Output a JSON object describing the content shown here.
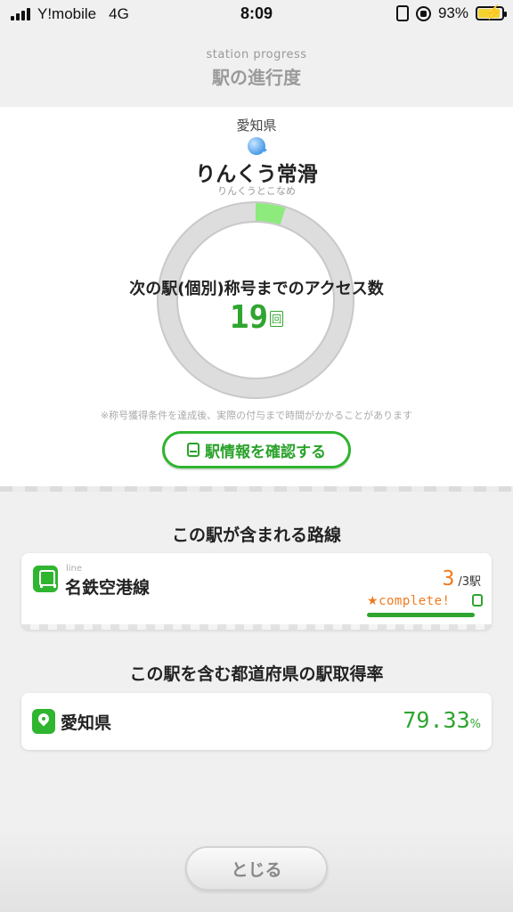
{
  "status_bar": {
    "carrier": "Y!mobile",
    "network": "4G",
    "time": "8:09",
    "battery_percent": "93%",
    "battery_level": 0.93,
    "battery_color": "#f4d230"
  },
  "header": {
    "subtitle": "station progress",
    "title": "駅の進行度"
  },
  "station": {
    "prefecture": "愛知県",
    "name": "りんくう常滑",
    "kana": "りんくうとこなめ",
    "orb_icon": "blue-orb-icon"
  },
  "progress": {
    "label": "次の駅(個別)称号までのアクセス数",
    "remaining": "19",
    "unit": "回",
    "fraction_complete": 0.05,
    "ring_color": "#dddddd",
    "fill_color": "#8ceb7c"
  },
  "note": "※称号獲得条件を達成後、実際の付与まで時間がかかることがあります",
  "info_button": {
    "label": "駅情報を確認する",
    "icon": "train-icon"
  },
  "lines_section": {
    "title": "この駅が含まれる路線",
    "items": [
      {
        "tag": "line",
        "name": "名鉄空港線",
        "acquired": "3",
        "total": "/3駅",
        "status": "complete!",
        "progress": 1.0
      }
    ]
  },
  "prefecture_section": {
    "title": "この駅を含む都道府県の駅取得率",
    "name": "愛知県",
    "rate": "79.33",
    "rate_unit": "%"
  },
  "close_button": {
    "label": "とじる"
  },
  "colors": {
    "accent_green": "#2fb52f",
    "accent_orange": "#f07a1e"
  }
}
